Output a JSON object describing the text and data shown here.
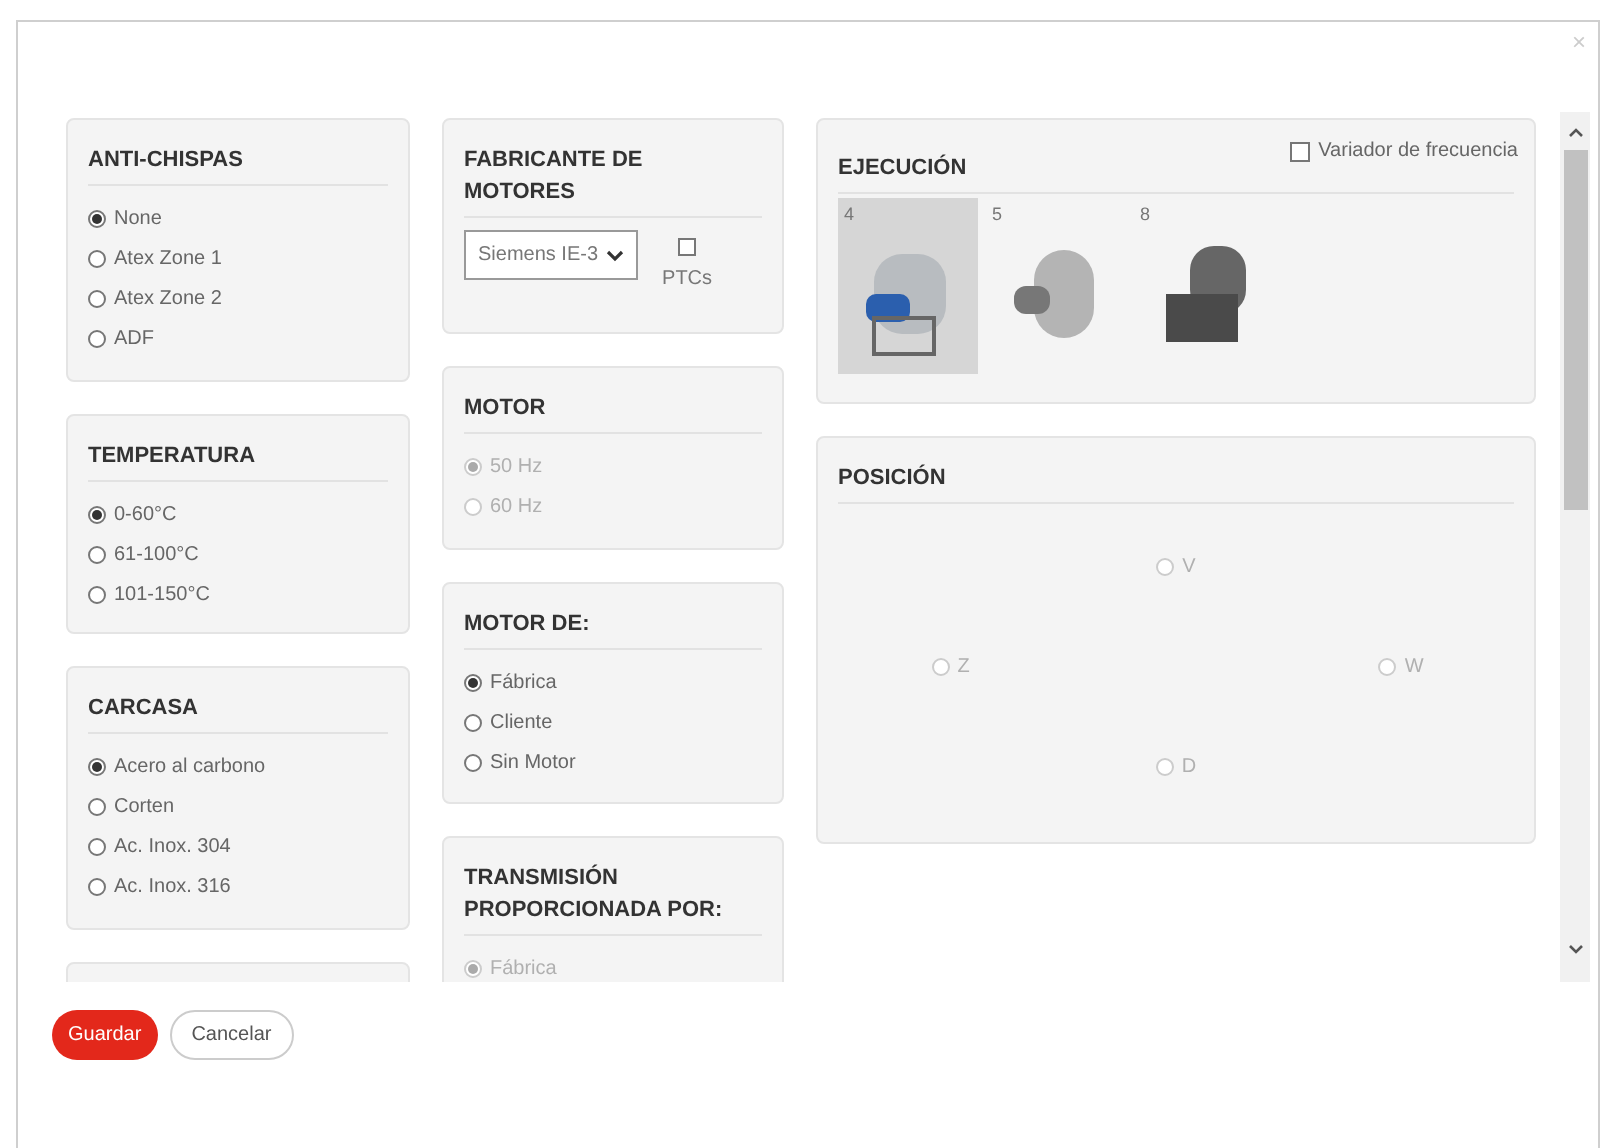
{
  "close": "×",
  "anti_chispas": {
    "title": "ANTI-CHISPAS",
    "options": [
      {
        "label": "None",
        "selected": true,
        "disabled": false
      },
      {
        "label": "Atex Zone 1",
        "selected": false,
        "disabled": false
      },
      {
        "label": "Atex Zone 2",
        "selected": false,
        "disabled": false
      },
      {
        "label": "ADF",
        "selected": false,
        "disabled": false
      }
    ]
  },
  "temperatura": {
    "title": "TEMPERATURA",
    "options": [
      {
        "label": "0-60°C",
        "selected": true,
        "disabled": false
      },
      {
        "label": "61-100°C",
        "selected": false,
        "disabled": false
      },
      {
        "label": "101-150°C",
        "selected": false,
        "disabled": false
      }
    ]
  },
  "carcasa": {
    "title": "CARCASA",
    "options": [
      {
        "label": "Acero al carbono",
        "selected": true,
        "disabled": false
      },
      {
        "label": "Corten",
        "selected": false,
        "disabled": false
      },
      {
        "label": "Ac. Inox. 304",
        "selected": false,
        "disabled": false
      },
      {
        "label": "Ac. Inox. 316",
        "selected": false,
        "disabled": false
      }
    ]
  },
  "fabricante": {
    "title": "FABRICANTE DE MOTORES",
    "select_value": "Siemens IE-3",
    "ptcs": {
      "label": "PTCs",
      "checked": false
    }
  },
  "motor": {
    "title": "MOTOR",
    "options": [
      {
        "label": "50 Hz",
        "selected": true,
        "disabled": true
      },
      {
        "label": "60 Hz",
        "selected": false,
        "disabled": true
      }
    ]
  },
  "motor_de": {
    "title": "MOTOR DE:",
    "options": [
      {
        "label": "Fábrica",
        "selected": true,
        "disabled": false
      },
      {
        "label": "Cliente",
        "selected": false,
        "disabled": false
      },
      {
        "label": "Sin Motor",
        "selected": false,
        "disabled": false
      }
    ]
  },
  "transmision": {
    "title": "TRANSMISIÓN PROPORCIONADA POR:",
    "options": [
      {
        "label": "Fábrica",
        "selected": true,
        "disabled": true
      }
    ]
  },
  "ejecucion": {
    "title": "EJECUCIÓN",
    "variador": {
      "label": "Variador de frecuencia",
      "checked": false
    },
    "options": [
      {
        "label": "4",
        "selected": true
      },
      {
        "label": "5",
        "selected": false
      },
      {
        "label": "8",
        "selected": false
      }
    ]
  },
  "posicion": {
    "title": "POSICIÓN",
    "options": [
      {
        "label": "V",
        "selected": false,
        "disabled": true
      },
      {
        "label": "Z",
        "selected": false,
        "disabled": true
      },
      {
        "label": "W",
        "selected": false,
        "disabled": true
      },
      {
        "label": "D",
        "selected": false,
        "disabled": true
      }
    ]
  },
  "buttons": {
    "save": "Guardar",
    "cancel": "Cancelar"
  }
}
